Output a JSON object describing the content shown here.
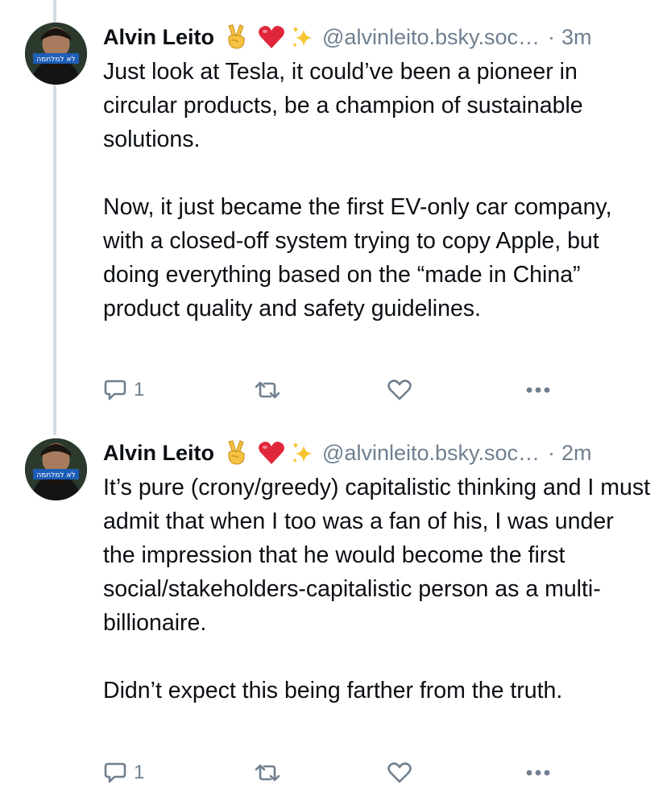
{
  "thread": {
    "posts": [
      {
        "author": {
          "display_name": "Alvin Leito",
          "emojis": [
            "✌",
            "❤",
            "✨"
          ],
          "handle": "@alvinleito.bsky.soc…",
          "avatar_caption": "לא למלחמה"
        },
        "separator": "·",
        "time": "3m",
        "paragraphs": [
          "Just look at Tesla, it could’ve been a pioneer in circular products, be a champion of sustainable solutions.",
          "Now, it just became the first EV-only car company, with a closed-off system trying to copy Apple, but doing everything based on the “made in China” product quality and safety guidelines."
        ],
        "reply_count": "1",
        "icons": {
          "reply": "reply-bubble-icon",
          "repost": "repost-icon",
          "like": "heart-icon",
          "more": "more-dots-icon"
        }
      },
      {
        "author": {
          "display_name": "Alvin Leito",
          "emojis": [
            "✌",
            "❤",
            "✨"
          ],
          "handle": "@alvinleito.bsky.soc…",
          "avatar_caption": "לא למלחמה"
        },
        "separator": "·",
        "time": "2m",
        "paragraphs": [
          "It’s pure (crony/greedy) capitalistic thinking and I must admit that when I too was a fan of his, I was under the impression that he would become the first social/stakeholders-capitalistic person as a multi-billionaire.",
          "Didn’t expect this being farther from the truth."
        ],
        "reply_count": "1",
        "icons": {
          "reply": "reply-bubble-icon",
          "repost": "repost-icon",
          "like": "heart-icon",
          "more": "more-dots-icon"
        }
      }
    ]
  },
  "colors": {
    "text": "#0b0f14",
    "muted": "#6f7f8f",
    "thread_line": "#d4dbe2",
    "avatar_band": "#1d5db8",
    "heart": "#e0263b",
    "peace_hand": "#f6c242",
    "sparkle": "#f7c531"
  }
}
